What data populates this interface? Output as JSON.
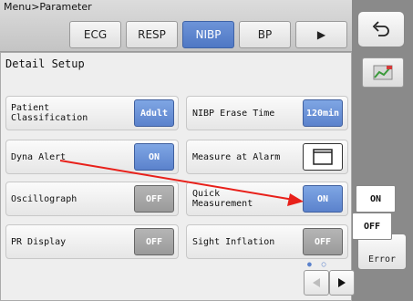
{
  "header": {
    "breadcrumb": "Menu>Parameter",
    "tabs": [
      {
        "label": "ECG",
        "active": false
      },
      {
        "label": "RESP",
        "active": false
      },
      {
        "label": "NIBP",
        "active": true
      },
      {
        "label": "BP",
        "active": false
      },
      {
        "label": "▶",
        "active": false
      }
    ]
  },
  "panel": {
    "title": "Detail Setup",
    "left_rows": [
      {
        "label": "Patient Classification",
        "value": "Adult",
        "style": "blue"
      },
      {
        "label": "Dyna Alert",
        "value": "ON",
        "style": "blue"
      },
      {
        "label": "Oscillograph",
        "value": "OFF",
        "style": "gray"
      },
      {
        "label": "PR Display",
        "value": "OFF",
        "style": "gray"
      }
    ],
    "right_rows": [
      {
        "label": "NIBP Erase Time",
        "value": "120min",
        "style": "blue"
      },
      {
        "label": "Measure at Alarm",
        "value": "",
        "style": "white"
      },
      {
        "label": "Quick Measurement",
        "value": "ON",
        "style": "blue"
      },
      {
        "label": "Sight Inflation",
        "value": "OFF",
        "style": "gray"
      }
    ]
  },
  "popup": {
    "options": [
      "ON",
      "OFF"
    ]
  },
  "side": {
    "error_label": "Error"
  },
  "pager": {
    "dots": "● ○"
  },
  "colors": {
    "accent": "#5b82cc",
    "arrow": "#e8201a"
  }
}
